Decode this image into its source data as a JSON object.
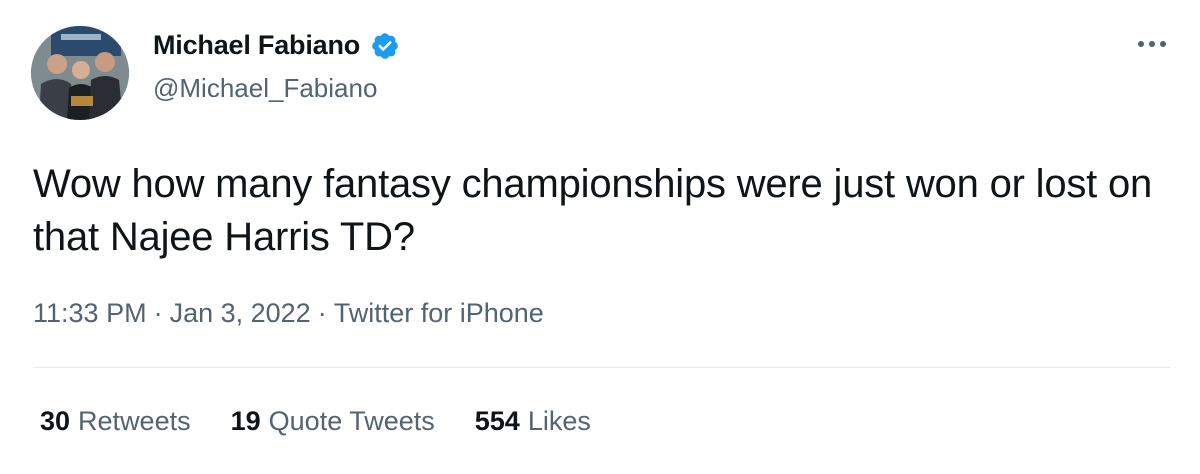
{
  "author": {
    "display_name": "Michael Fabiano",
    "handle": "@Michael_Fabiano",
    "verified": true,
    "verified_color": "#1d9bf0"
  },
  "tweet": {
    "text": "Wow how many fantasy championships were just won or lost on that Najee Harris TD?",
    "time": "11:33 PM",
    "separator": "·",
    "date": "Jan 3, 2022",
    "source": "Twitter for iPhone"
  },
  "stats": {
    "retweets": {
      "count": "30",
      "label": "Retweets"
    },
    "quote_tweets": {
      "count": "19",
      "label": "Quote Tweets"
    },
    "likes": {
      "count": "554",
      "label": "Likes"
    }
  },
  "icons": {
    "verified": "verified-badge-icon",
    "more": "more-options-icon"
  }
}
